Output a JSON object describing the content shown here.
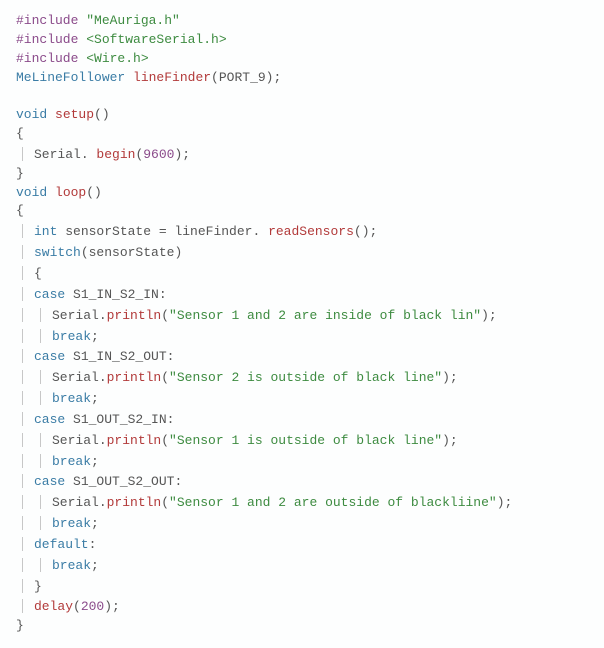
{
  "lines": [
    {
      "indent": 0,
      "segs": [
        [
          "macro",
          "#include "
        ],
        [
          "str",
          "\"MeAuriga.h\""
        ]
      ]
    },
    {
      "indent": 0,
      "segs": [
        [
          "macro",
          "#include "
        ],
        [
          "str",
          "<SoftwareSerial.h>"
        ]
      ]
    },
    {
      "indent": 0,
      "segs": [
        [
          "macro",
          "#include "
        ],
        [
          "str",
          "<Wire.h>"
        ]
      ]
    },
    {
      "indent": 0,
      "segs": [
        [
          "type",
          "MeLineFollower "
        ],
        [
          "fn",
          "lineFinder"
        ],
        [
          "punct",
          "("
        ],
        [
          "ident",
          "PORT_9"
        ],
        [
          "punct",
          ");"
        ]
      ]
    },
    {
      "blank": true
    },
    {
      "indent": 0,
      "segs": [
        [
          "kw",
          "void "
        ],
        [
          "fn",
          "setup"
        ],
        [
          "punct",
          "()"
        ]
      ]
    },
    {
      "indent": 0,
      "segs": [
        [
          "punct",
          "{"
        ]
      ]
    },
    {
      "indent": 1,
      "segs": [
        [
          "ident",
          "Serial"
        ],
        [
          "punct",
          ". "
        ],
        [
          "fn",
          "begin"
        ],
        [
          "punct",
          "("
        ],
        [
          "num",
          "9600"
        ],
        [
          "punct",
          ");"
        ]
      ]
    },
    {
      "indent": 0,
      "segs": [
        [
          "punct",
          "}"
        ]
      ]
    },
    {
      "indent": 0,
      "segs": [
        [
          "kw",
          "void "
        ],
        [
          "fn",
          "loop"
        ],
        [
          "punct",
          "()"
        ]
      ]
    },
    {
      "indent": 0,
      "segs": [
        [
          "punct",
          "{"
        ]
      ]
    },
    {
      "indent": 1,
      "segs": [
        [
          "kw",
          "int "
        ],
        [
          "ident",
          "sensorState "
        ],
        [
          "punct",
          "= "
        ],
        [
          "ident",
          "lineFinder"
        ],
        [
          "punct",
          ". "
        ],
        [
          "fn",
          "readSensors"
        ],
        [
          "punct",
          "();"
        ]
      ]
    },
    {
      "indent": 1,
      "segs": [
        [
          "kw",
          "switch"
        ],
        [
          "punct",
          "("
        ],
        [
          "ident",
          "sensorState"
        ],
        [
          "punct",
          ")"
        ]
      ]
    },
    {
      "indent": 1,
      "segs": [
        [
          "punct",
          "{"
        ]
      ]
    },
    {
      "indent": 1,
      "segs": [
        [
          "kw",
          "case "
        ],
        [
          "ident",
          "S1_IN_S2_IN"
        ],
        [
          "punct",
          ":"
        ]
      ]
    },
    {
      "indent": 2,
      "segs": [
        [
          "ident",
          "Serial"
        ],
        [
          "punct",
          "."
        ],
        [
          "fn",
          "println"
        ],
        [
          "punct",
          "("
        ],
        [
          "str",
          "\"Sensor 1 and 2 are inside of black lin\""
        ],
        [
          "punct",
          ");"
        ]
      ]
    },
    {
      "indent": 2,
      "segs": [
        [
          "kw",
          "break"
        ],
        [
          "punct",
          ";"
        ]
      ]
    },
    {
      "indent": 1,
      "segs": [
        [
          "kw",
          "case "
        ],
        [
          "ident",
          "S1_IN_S2_OUT"
        ],
        [
          "punct",
          ":"
        ]
      ]
    },
    {
      "indent": 2,
      "segs": [
        [
          "ident",
          "Serial"
        ],
        [
          "punct",
          "."
        ],
        [
          "fn",
          "println"
        ],
        [
          "punct",
          "("
        ],
        [
          "str",
          "\"Sensor 2 is outside of black line\""
        ],
        [
          "punct",
          ");"
        ]
      ]
    },
    {
      "indent": 2,
      "segs": [
        [
          "kw",
          "break"
        ],
        [
          "punct",
          ";"
        ]
      ]
    },
    {
      "indent": 1,
      "segs": [
        [
          "kw",
          "case "
        ],
        [
          "ident",
          "S1_OUT_S2_IN"
        ],
        [
          "punct",
          ":"
        ]
      ]
    },
    {
      "indent": 2,
      "segs": [
        [
          "ident",
          "Serial"
        ],
        [
          "punct",
          "."
        ],
        [
          "fn",
          "println"
        ],
        [
          "punct",
          "("
        ],
        [
          "str",
          "\"Sensor 1 is outside of black line\""
        ],
        [
          "punct",
          ");"
        ]
      ]
    },
    {
      "indent": 2,
      "segs": [
        [
          "kw",
          "break"
        ],
        [
          "punct",
          ";"
        ]
      ]
    },
    {
      "indent": 1,
      "segs": [
        [
          "kw",
          "case "
        ],
        [
          "ident",
          "S1_OUT_S2_OUT"
        ],
        [
          "punct",
          ":"
        ]
      ]
    },
    {
      "indent": 2,
      "segs": [
        [
          "ident",
          "Serial"
        ],
        [
          "punct",
          "."
        ],
        [
          "fn",
          "println"
        ],
        [
          "punct",
          "("
        ],
        [
          "str",
          "\"Sensor 1 and 2 are outside of blackliine\""
        ],
        [
          "punct",
          ");"
        ]
      ]
    },
    {
      "indent": 2,
      "segs": [
        [
          "kw",
          "break"
        ],
        [
          "punct",
          ";"
        ]
      ]
    },
    {
      "indent": 1,
      "segs": [
        [
          "kw",
          "default"
        ],
        [
          "punct",
          ":"
        ]
      ]
    },
    {
      "indent": 2,
      "segs": [
        [
          "kw",
          "break"
        ],
        [
          "punct",
          ";"
        ]
      ]
    },
    {
      "indent": 1,
      "segs": [
        [
          "punct",
          "}"
        ]
      ]
    },
    {
      "indent": 1,
      "segs": [
        [
          "fn",
          "delay"
        ],
        [
          "punct",
          "("
        ],
        [
          "num",
          "200"
        ],
        [
          "punct",
          ");"
        ]
      ]
    },
    {
      "indent": 0,
      "segs": [
        [
          "punct",
          "}"
        ]
      ]
    }
  ]
}
